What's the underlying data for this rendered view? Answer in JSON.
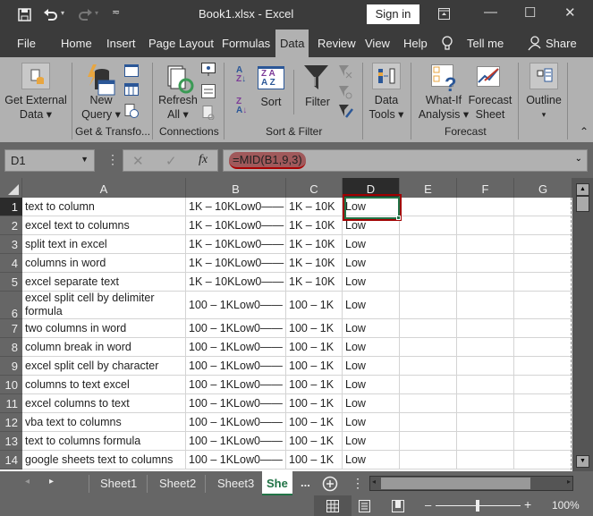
{
  "titlebar": {
    "title": "Book1.xlsx  -  Excel",
    "signin": "Sign in",
    "icons": [
      "save-icon",
      "undo-icon",
      "redo-icon",
      "customize-qat-icon",
      "ribbon-display-icon",
      "minimize-icon",
      "maximize-icon",
      "close-icon"
    ],
    "glyphs": {
      "minimize": "—",
      "maximize": "☐",
      "close": "✕"
    }
  },
  "tabs": [
    {
      "label": "File"
    },
    {
      "label": "Home"
    },
    {
      "label": "Insert"
    },
    {
      "label": "Page Layout"
    },
    {
      "label": "Formulas"
    },
    {
      "label": "Data",
      "active": true
    },
    {
      "label": "Review"
    },
    {
      "label": "View"
    },
    {
      "label": "Help"
    },
    {
      "label": "Tell me"
    },
    {
      "label": "Share"
    }
  ],
  "ribbon": {
    "get_external_data": {
      "line1": "Get External",
      "line2": "Data ▾"
    },
    "new_query": {
      "line1": "New",
      "line2": "Query ▾"
    },
    "refresh_all": {
      "line1": "Refresh",
      "line2": "All ▾"
    },
    "sort": "Sort",
    "filter": "Filter",
    "data_tools": {
      "line1": "Data",
      "line2": "Tools ▾"
    },
    "what_if": {
      "line1": "What-If",
      "line2": "Analysis ▾"
    },
    "forecast_sheet": {
      "line1": "Forecast",
      "line2": "Sheet"
    },
    "outline": {
      "line1": "Outline",
      "line2": "▾"
    },
    "groups": {
      "get_transform": "Get & Transfo...",
      "connections": "Connections",
      "sort_filter": "Sort & Filter",
      "forecast": "Forecast"
    },
    "collapse": "⌃"
  },
  "formula_bar": {
    "name_box": "D1",
    "cancel": "✕",
    "enter": "✓",
    "fx": "fx",
    "formula": "=MID(B1,9,3)"
  },
  "columns": [
    "A",
    "B",
    "C",
    "D",
    "E",
    "F",
    "G"
  ],
  "selected_cell": "D1",
  "rows": [
    {
      "n": "1",
      "A": "text to column",
      "B": "1K – 10KLow0——",
      "C": "1K – 10K",
      "D": "Low"
    },
    {
      "n": "2",
      "A": "excel text to columns",
      "B": "1K – 10KLow0——",
      "C": "1K – 10K",
      "D": "Low"
    },
    {
      "n": "3",
      "A": "split text in excel",
      "B": "1K – 10KLow0——",
      "C": "1K – 10K",
      "D": "Low"
    },
    {
      "n": "4",
      "A": "columns in word",
      "B": "1K – 10KLow0——",
      "C": "1K – 10K",
      "D": "Low"
    },
    {
      "n": "5",
      "A": "excel separate text",
      "B": "1K – 10KLow0——",
      "C": "1K – 10K",
      "D": "Low"
    },
    {
      "n": "6",
      "A": "excel split cell by delimiter formula",
      "B": "100 – 1KLow0——",
      "C": "100 – 1K",
      "D": "Low"
    },
    {
      "n": "7",
      "A": "two columns in word",
      "B": "100 – 1KLow0——",
      "C": "100 – 1K",
      "D": "Low"
    },
    {
      "n": "8",
      "A": "column break in word",
      "B": "100 – 1KLow0——",
      "C": "100 – 1K",
      "D": "Low"
    },
    {
      "n": "9",
      "A": "excel split cell by character",
      "B": "100 – 1KLow0——",
      "C": "100 – 1K",
      "D": "Low"
    },
    {
      "n": "10",
      "A": "columns to text excel",
      "B": "100 – 1KLow0——",
      "C": "100 – 1K",
      "D": "Low"
    },
    {
      "n": "11",
      "A": "excel columns to text",
      "B": "100 – 1KLow0——",
      "C": "100 – 1K",
      "D": "Low"
    },
    {
      "n": "12",
      "A": "vba text to columns",
      "B": "100 – 1KLow0——",
      "C": "100 – 1K",
      "D": "Low"
    },
    {
      "n": "13",
      "A": "text to columns formula",
      "B": "100 – 1KLow0——",
      "C": "100 – 1K",
      "D": "Low"
    },
    {
      "n": "14",
      "A": "google sheets text to columns",
      "B": "100 – 1KLow0——",
      "C": "100 – 1K",
      "D": "Low"
    }
  ],
  "sheet_tabs": [
    {
      "label": "Sheet1"
    },
    {
      "label": "Sheet2"
    },
    {
      "label": "Sheet3"
    },
    {
      "label": "She",
      "active": true
    }
  ],
  "sheet_more": "...",
  "status": {
    "zoom": "100%",
    "minus": "–",
    "plus": "+",
    "zoom_level_percent": 100
  },
  "colors": {
    "accent": "#217346",
    "highlight": "#a00000",
    "ribbon": "#b1b1b1",
    "titlebar": "#3b3b3b"
  }
}
